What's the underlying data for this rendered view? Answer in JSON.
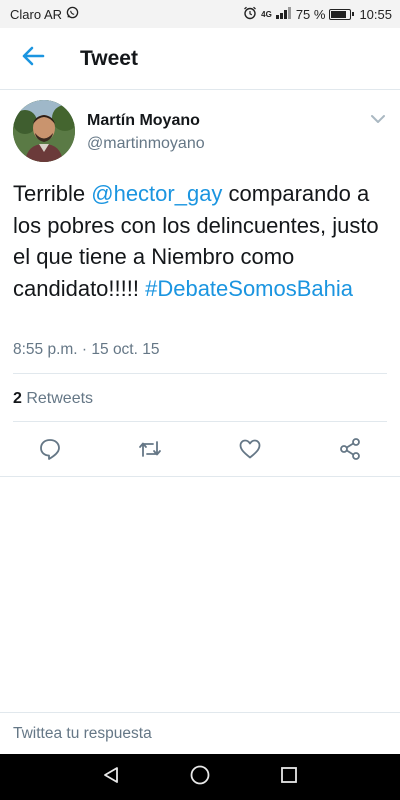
{
  "status_bar": {
    "carrier": "Claro AR",
    "network": "4G",
    "battery": "75 %",
    "battery_level": 0.75,
    "time": "10:55"
  },
  "app_bar": {
    "title": "Tweet",
    "back_icon": "arrow-left-icon"
  },
  "tweet": {
    "author": {
      "name": "Martín Moyano",
      "handle": "@martinmoyano"
    },
    "text": {
      "part1": "Terrible ",
      "mention": "@hector_gay",
      "part2": " comparando a los pobres con los delincuentes, justo el que tiene a Niembro como candidato!!!!! ",
      "hashtag": "#DebateSomosBahia"
    },
    "timestamp": "8:55 p.m. · 15 oct. 15",
    "stats": {
      "retweet_count": "2",
      "retweet_label": " Retweets"
    },
    "actions": [
      "reply-icon",
      "retweet-icon",
      "like-icon",
      "share-icon"
    ]
  },
  "reply": {
    "placeholder": "Twittea tu respuesta"
  },
  "colors": {
    "accent": "#1b95e0",
    "secondary_text": "#657786",
    "divider": "#e1e8ed"
  },
  "nav_bar": [
    "back-triangle-icon",
    "home-circle-icon",
    "recents-square-icon"
  ]
}
